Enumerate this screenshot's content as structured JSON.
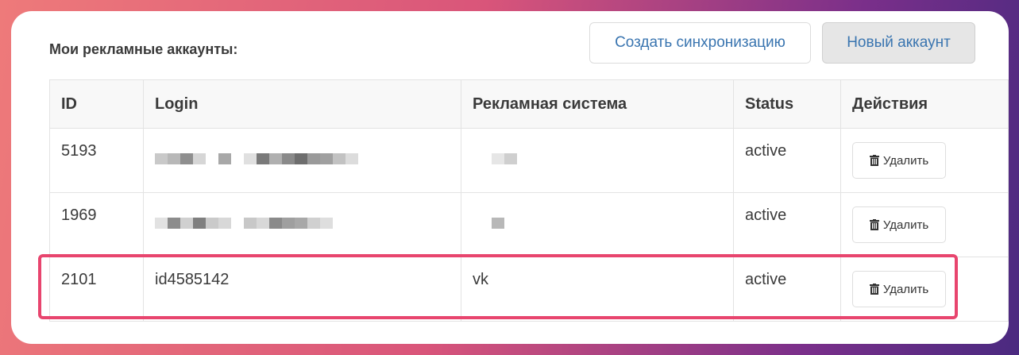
{
  "heading": "Мои рекламные аккаунты:",
  "buttons": {
    "create_sync": "Создать синхронизацию",
    "new_account": "Новый аккаунт"
  },
  "table": {
    "headers": [
      "ID",
      "Login",
      "Рекламная система",
      "Status",
      "Действия"
    ],
    "rows": [
      {
        "id": "5193",
        "login": "",
        "system": "",
        "status": "active",
        "action": "Удалить",
        "redacted": true
      },
      {
        "id": "1969",
        "login": "",
        "system": "",
        "status": "active",
        "action": "Удалить",
        "redacted": true
      },
      {
        "id": "2101",
        "login": "id4585142",
        "system": "vk",
        "status": "active",
        "action": "Удалить",
        "redacted": false
      }
    ]
  },
  "colors": {
    "highlight": "#e8456e",
    "link": "#3a75b0"
  },
  "icons": {
    "delete": "trash-icon"
  }
}
